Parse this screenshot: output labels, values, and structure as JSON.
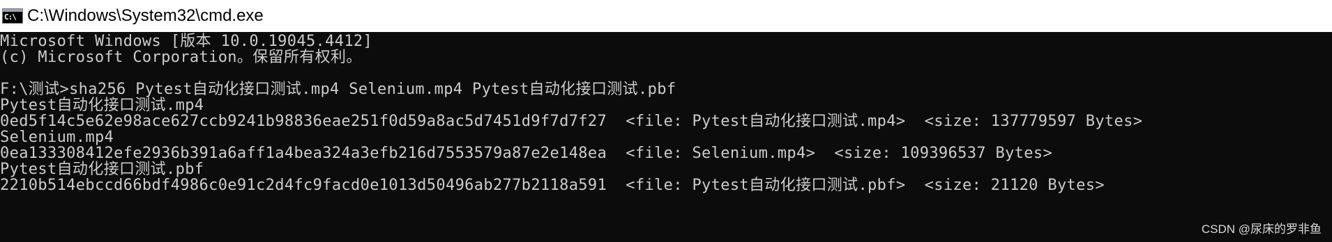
{
  "window": {
    "title": "C:\\Windows\\System32\\cmd.exe",
    "icon": "cmd-icon",
    "icon_text": "C:\\"
  },
  "console": {
    "lines": [
      "Microsoft Windows [版本 10.0.19045.4412]",
      "(c) Microsoft Corporation。保留所有权利。",
      "",
      "F:\\测试>sha256 Pytest自动化接口测试.mp4 Selenium.mp4 Pytest自动化接口测试.pbf",
      "Pytest自动化接口测试.mp4",
      "0ed5f14c5e62e98ace627ccb9241b98836eae251f0d59a8ac5d7451d9f7d7f27  <file: Pytest自动化接口测试.mp4>  <size: 137779597 Bytes>",
      "Selenium.mp4",
      "0ea133308412efe2936b391a6aff1a4bea324a3efb216d7553579a87e2e148ea  <file: Selenium.mp4>  <size: 109396537 Bytes>",
      "Pytest自动化接口测试.pbf",
      "2210b514ebccd66bdf4986c0e91c2d4fc9facd0e1013d50496ab277b2118a591  <file: Pytest自动化接口测试.pbf>  <size: 21120 Bytes>"
    ]
  },
  "watermark": "CSDN @尿床的罗非鱼",
  "colors": {
    "console_bg": "#0c0c0c",
    "console_text": "#cccccc",
    "titlebar_bg": "#ffffff"
  }
}
